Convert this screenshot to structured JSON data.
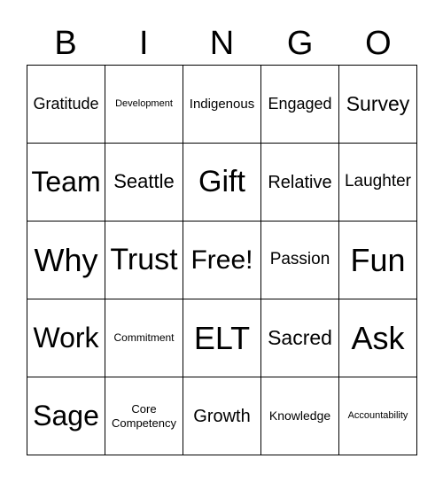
{
  "header": [
    "B",
    "I",
    "N",
    "G",
    "O"
  ],
  "cells": [
    "Gratitude",
    "Development",
    "Indigenous",
    "Engaged",
    "Survey",
    "Team",
    "Seattle",
    "Gift",
    "Relative",
    "Laughter",
    "Why",
    "Trust",
    "Free!",
    "Passion",
    "Fun",
    "Work",
    "Commitment",
    "ELT",
    "Sacred",
    "Ask",
    "Sage",
    "Core\nCompetency",
    "Growth",
    "Knowledge",
    "Accountability"
  ]
}
